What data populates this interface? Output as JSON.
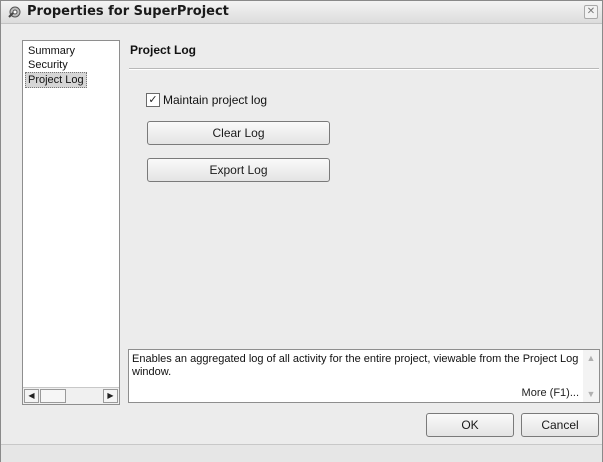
{
  "window": {
    "title": "Properties for SuperProject",
    "close_glyph": "✕"
  },
  "nav": {
    "items": [
      {
        "label": "Summary",
        "selected": false
      },
      {
        "label": "Security",
        "selected": false
      },
      {
        "label": "Project Log",
        "selected": true
      }
    ],
    "scroll_left_glyph": "◀",
    "scroll_right_glyph": "▶"
  },
  "panel": {
    "title": "Project Log",
    "checkbox": {
      "label": "Maintain project log",
      "checked": true,
      "glyph": "✓"
    },
    "clear_label": "Clear Log",
    "export_label": "Export Log"
  },
  "description": {
    "text": "Enables an aggregated log of all activity for the entire project, viewable from the Project Log window.",
    "more_label": "More (F1)...",
    "scroll_up_glyph": "▲",
    "scroll_down_glyph": "▼"
  },
  "footer": {
    "ok_label": "OK",
    "cancel_label": "Cancel"
  },
  "icons": [
    "app-icon",
    "close-icon",
    "check-icon",
    "scroll-left-icon",
    "scroll-right-icon",
    "scroll-up-icon",
    "scroll-down-icon"
  ],
  "colors": {
    "window_bg": "#ececec",
    "selection_bg": "#d6d6d6"
  }
}
